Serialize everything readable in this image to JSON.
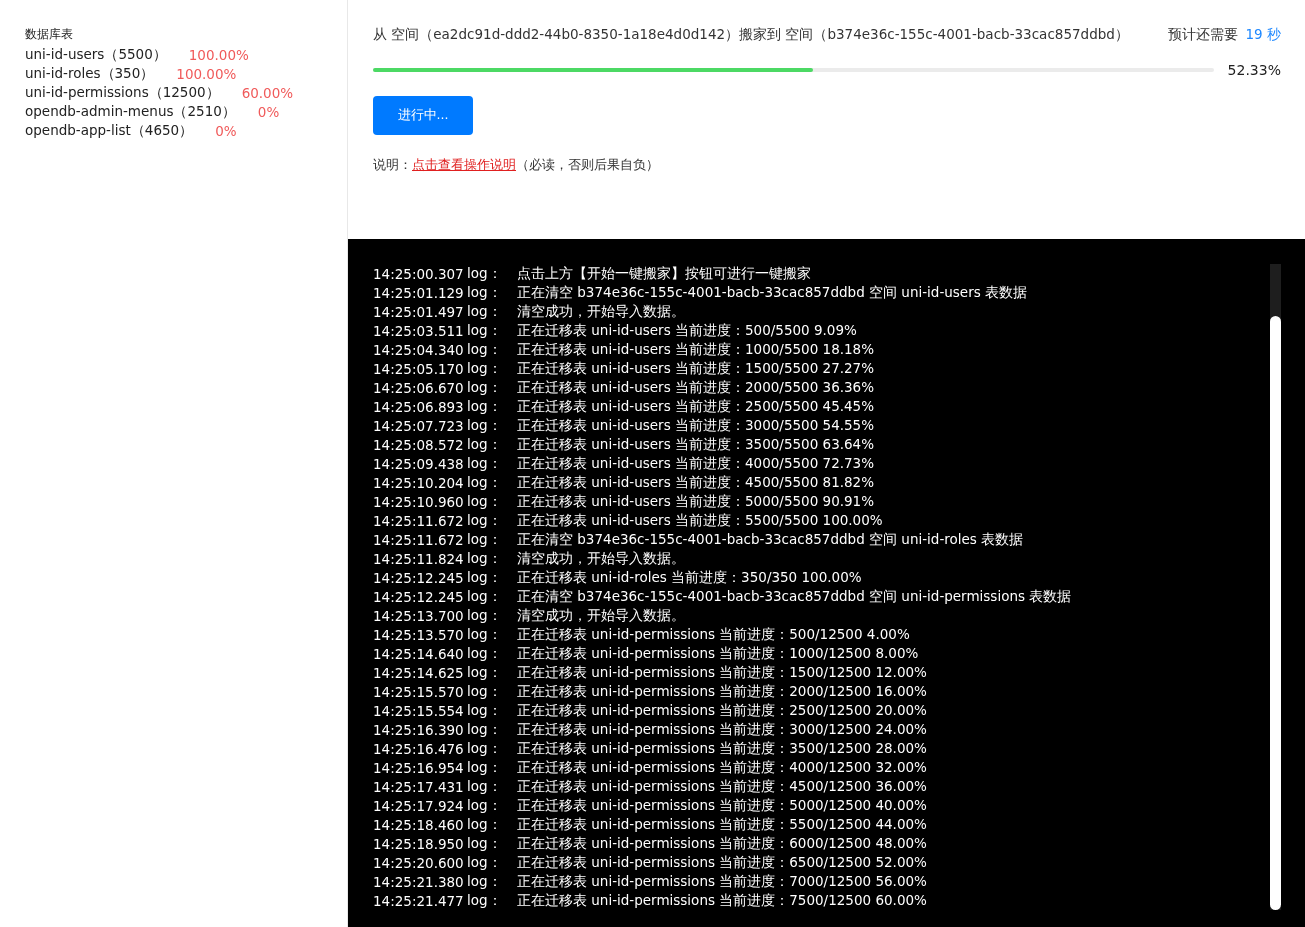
{
  "sidebar": {
    "title": "数据库表",
    "tables": [
      {
        "name": "uni-id-users（5500）",
        "percent": "100.00%"
      },
      {
        "name": "uni-id-roles（350）",
        "percent": "100.00%"
      },
      {
        "name": "uni-id-permissions（12500）",
        "percent": "60.00%"
      },
      {
        "name": "opendb-admin-menus（2510）",
        "percent": "0%"
      },
      {
        "name": "opendb-app-list（4650）",
        "percent": "0%"
      }
    ]
  },
  "migration": {
    "route": "从 空间（ea2dc91d-ddd2-44b0-8350-1a18e4d0d142）搬家到 空间（b374e36c-155c-4001-bacb-33cac857ddbd）",
    "eta_label": "预计还需要",
    "eta_value": "19 秒",
    "progress": {
      "level": 0.5233,
      "reading": "52.33%"
    },
    "button": {
      "label": "进行中...",
      "disabled": true
    },
    "note": {
      "prefix": "说明：",
      "link": "点击查看操作说明",
      "suffix": "（必读，否则后果自负）"
    }
  },
  "log": [
    {
      "time": "14:25:00.307",
      "tag": "log：",
      "message": "点击上方【开始一键搬家】按钮可进行一键搬家"
    },
    {
      "time": "14:25:01.129",
      "tag": "log：",
      "message": "正在清空 b374e36c-155c-4001-bacb-33cac857ddbd 空间 uni-id-users 表数据"
    },
    {
      "time": "14:25:01.497",
      "tag": "log：",
      "message": "清空成功，开始导入数据。"
    },
    {
      "time": "14:25:03.511",
      "tag": "log：",
      "message": "正在迁移表 uni-id-users 当前进度：500/5500 9.09%"
    },
    {
      "time": "14:25:04.340",
      "tag": "log：",
      "message": "正在迁移表 uni-id-users 当前进度：1000/5500 18.18%"
    },
    {
      "time": "14:25:05.170",
      "tag": "log：",
      "message": "正在迁移表 uni-id-users 当前进度：1500/5500 27.27%"
    },
    {
      "time": "14:25:06.670",
      "tag": "log：",
      "message": "正在迁移表 uni-id-users 当前进度：2000/5500 36.36%"
    },
    {
      "time": "14:25:06.893",
      "tag": "log：",
      "message": "正在迁移表 uni-id-users 当前进度：2500/5500 45.45%"
    },
    {
      "time": "14:25:07.723",
      "tag": "log：",
      "message": "正在迁移表 uni-id-users 当前进度：3000/5500 54.55%"
    },
    {
      "time": "14:25:08.572",
      "tag": "log：",
      "message": "正在迁移表 uni-id-users 当前进度：3500/5500 63.64%"
    },
    {
      "time": "14:25:09.438",
      "tag": "log：",
      "message": "正在迁移表 uni-id-users 当前进度：4000/5500 72.73%"
    },
    {
      "time": "14:25:10.204",
      "tag": "log：",
      "message": "正在迁移表 uni-id-users 当前进度：4500/5500 81.82%"
    },
    {
      "time": "14:25:10.960",
      "tag": "log：",
      "message": "正在迁移表 uni-id-users 当前进度：5000/5500 90.91%"
    },
    {
      "time": "14:25:11.672",
      "tag": "log：",
      "message": "正在迁移表 uni-id-users 当前进度：5500/5500 100.00%"
    },
    {
      "time": "14:25:11.672",
      "tag": "log：",
      "message": "正在清空 b374e36c-155c-4001-bacb-33cac857ddbd 空间 uni-id-roles 表数据"
    },
    {
      "time": "14:25:11.824",
      "tag": "log：",
      "message": "清空成功，开始导入数据。"
    },
    {
      "time": "14:25:12.245",
      "tag": "log：",
      "message": "正在迁移表 uni-id-roles 当前进度：350/350 100.00%"
    },
    {
      "time": "14:25:12.245",
      "tag": "log：",
      "message": "正在清空 b374e36c-155c-4001-bacb-33cac857ddbd 空间 uni-id-permissions 表数据"
    },
    {
      "time": "14:25:13.700",
      "tag": "log：",
      "message": "清空成功，开始导入数据。"
    },
    {
      "time": "14:25:13.570",
      "tag": "log：",
      "message": "正在迁移表 uni-id-permissions 当前进度：500/12500 4.00%"
    },
    {
      "time": "14:25:14.640",
      "tag": "log：",
      "message": "正在迁移表 uni-id-permissions 当前进度：1000/12500 8.00%"
    },
    {
      "time": "14:25:14.625",
      "tag": "log：",
      "message": "正在迁移表 uni-id-permissions 当前进度：1500/12500 12.00%"
    },
    {
      "time": "14:25:15.570",
      "tag": "log：",
      "message": "正在迁移表 uni-id-permissions 当前进度：2000/12500 16.00%"
    },
    {
      "time": "14:25:15.554",
      "tag": "log：",
      "message": "正在迁移表 uni-id-permissions 当前进度：2500/12500 20.00%"
    },
    {
      "time": "14:25:16.390",
      "tag": "log：",
      "message": "正在迁移表 uni-id-permissions 当前进度：3000/12500 24.00%"
    },
    {
      "time": "14:25:16.476",
      "tag": "log：",
      "message": "正在迁移表 uni-id-permissions 当前进度：3500/12500 28.00%"
    },
    {
      "time": "14:25:16.954",
      "tag": "log：",
      "message": "正在迁移表 uni-id-permissions 当前进度：4000/12500 32.00%"
    },
    {
      "time": "14:25:17.431",
      "tag": "log：",
      "message": "正在迁移表 uni-id-permissions 当前进度：4500/12500 36.00%"
    },
    {
      "time": "14:25:17.924",
      "tag": "log：",
      "message": "正在迁移表 uni-id-permissions 当前进度：5000/12500 40.00%"
    },
    {
      "time": "14:25:18.460",
      "tag": "log：",
      "message": "正在迁移表 uni-id-permissions 当前进度：5500/12500 44.00%"
    },
    {
      "time": "14:25:18.950",
      "tag": "log：",
      "message": "正在迁移表 uni-id-permissions 当前进度：6000/12500 48.00%"
    },
    {
      "time": "14:25:20.600",
      "tag": "log：",
      "message": "正在迁移表 uni-id-permissions 当前进度：6500/12500 52.00%"
    },
    {
      "time": "14:25:21.380",
      "tag": "log：",
      "message": "正在迁移表 uni-id-permissions 当前进度：7000/12500 56.00%"
    },
    {
      "time": "14:25:21.477",
      "tag": "log：",
      "message": "正在迁移表 uni-id-permissions 当前进度：7500/12500 60.00%"
    }
  ]
}
